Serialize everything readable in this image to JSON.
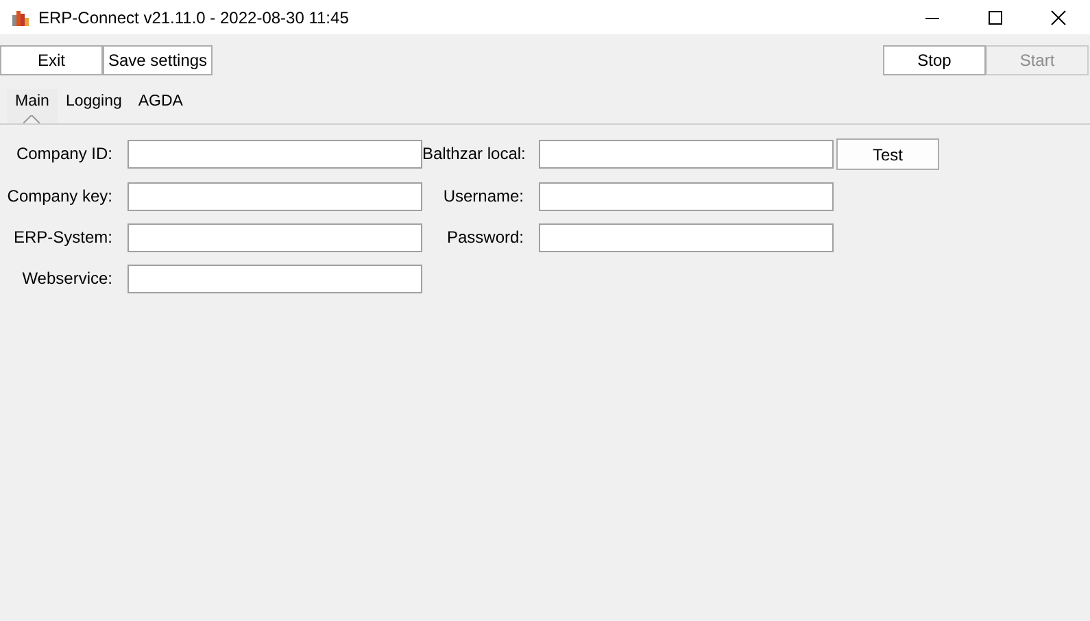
{
  "window": {
    "title": "ERP-Connect v21.11.0 - 2022-08-30 11:45"
  },
  "toolbar_left": [
    {
      "label": "Exit",
      "disabled": false
    },
    {
      "label": "Save settings",
      "disabled": false
    }
  ],
  "toolbar_right": [
    {
      "label": "Stop",
      "disabled": false
    },
    {
      "label": "Start",
      "disabled": true
    }
  ],
  "tabs": [
    {
      "label": "Main",
      "selected": true
    },
    {
      "label": "Logging",
      "selected": false
    },
    {
      "label": "AGDA",
      "selected": false
    }
  ],
  "fields_left": [
    {
      "label": "Company ID:"
    },
    {
      "label": "Company key:"
    },
    {
      "label": "ERP-System:"
    },
    {
      "label": "Webservice:"
    }
  ],
  "fields_right": [
    {
      "label": "Balthzar local:",
      "button": "Test"
    },
    {
      "label": "Username:"
    },
    {
      "label": "Password:"
    }
  ]
}
